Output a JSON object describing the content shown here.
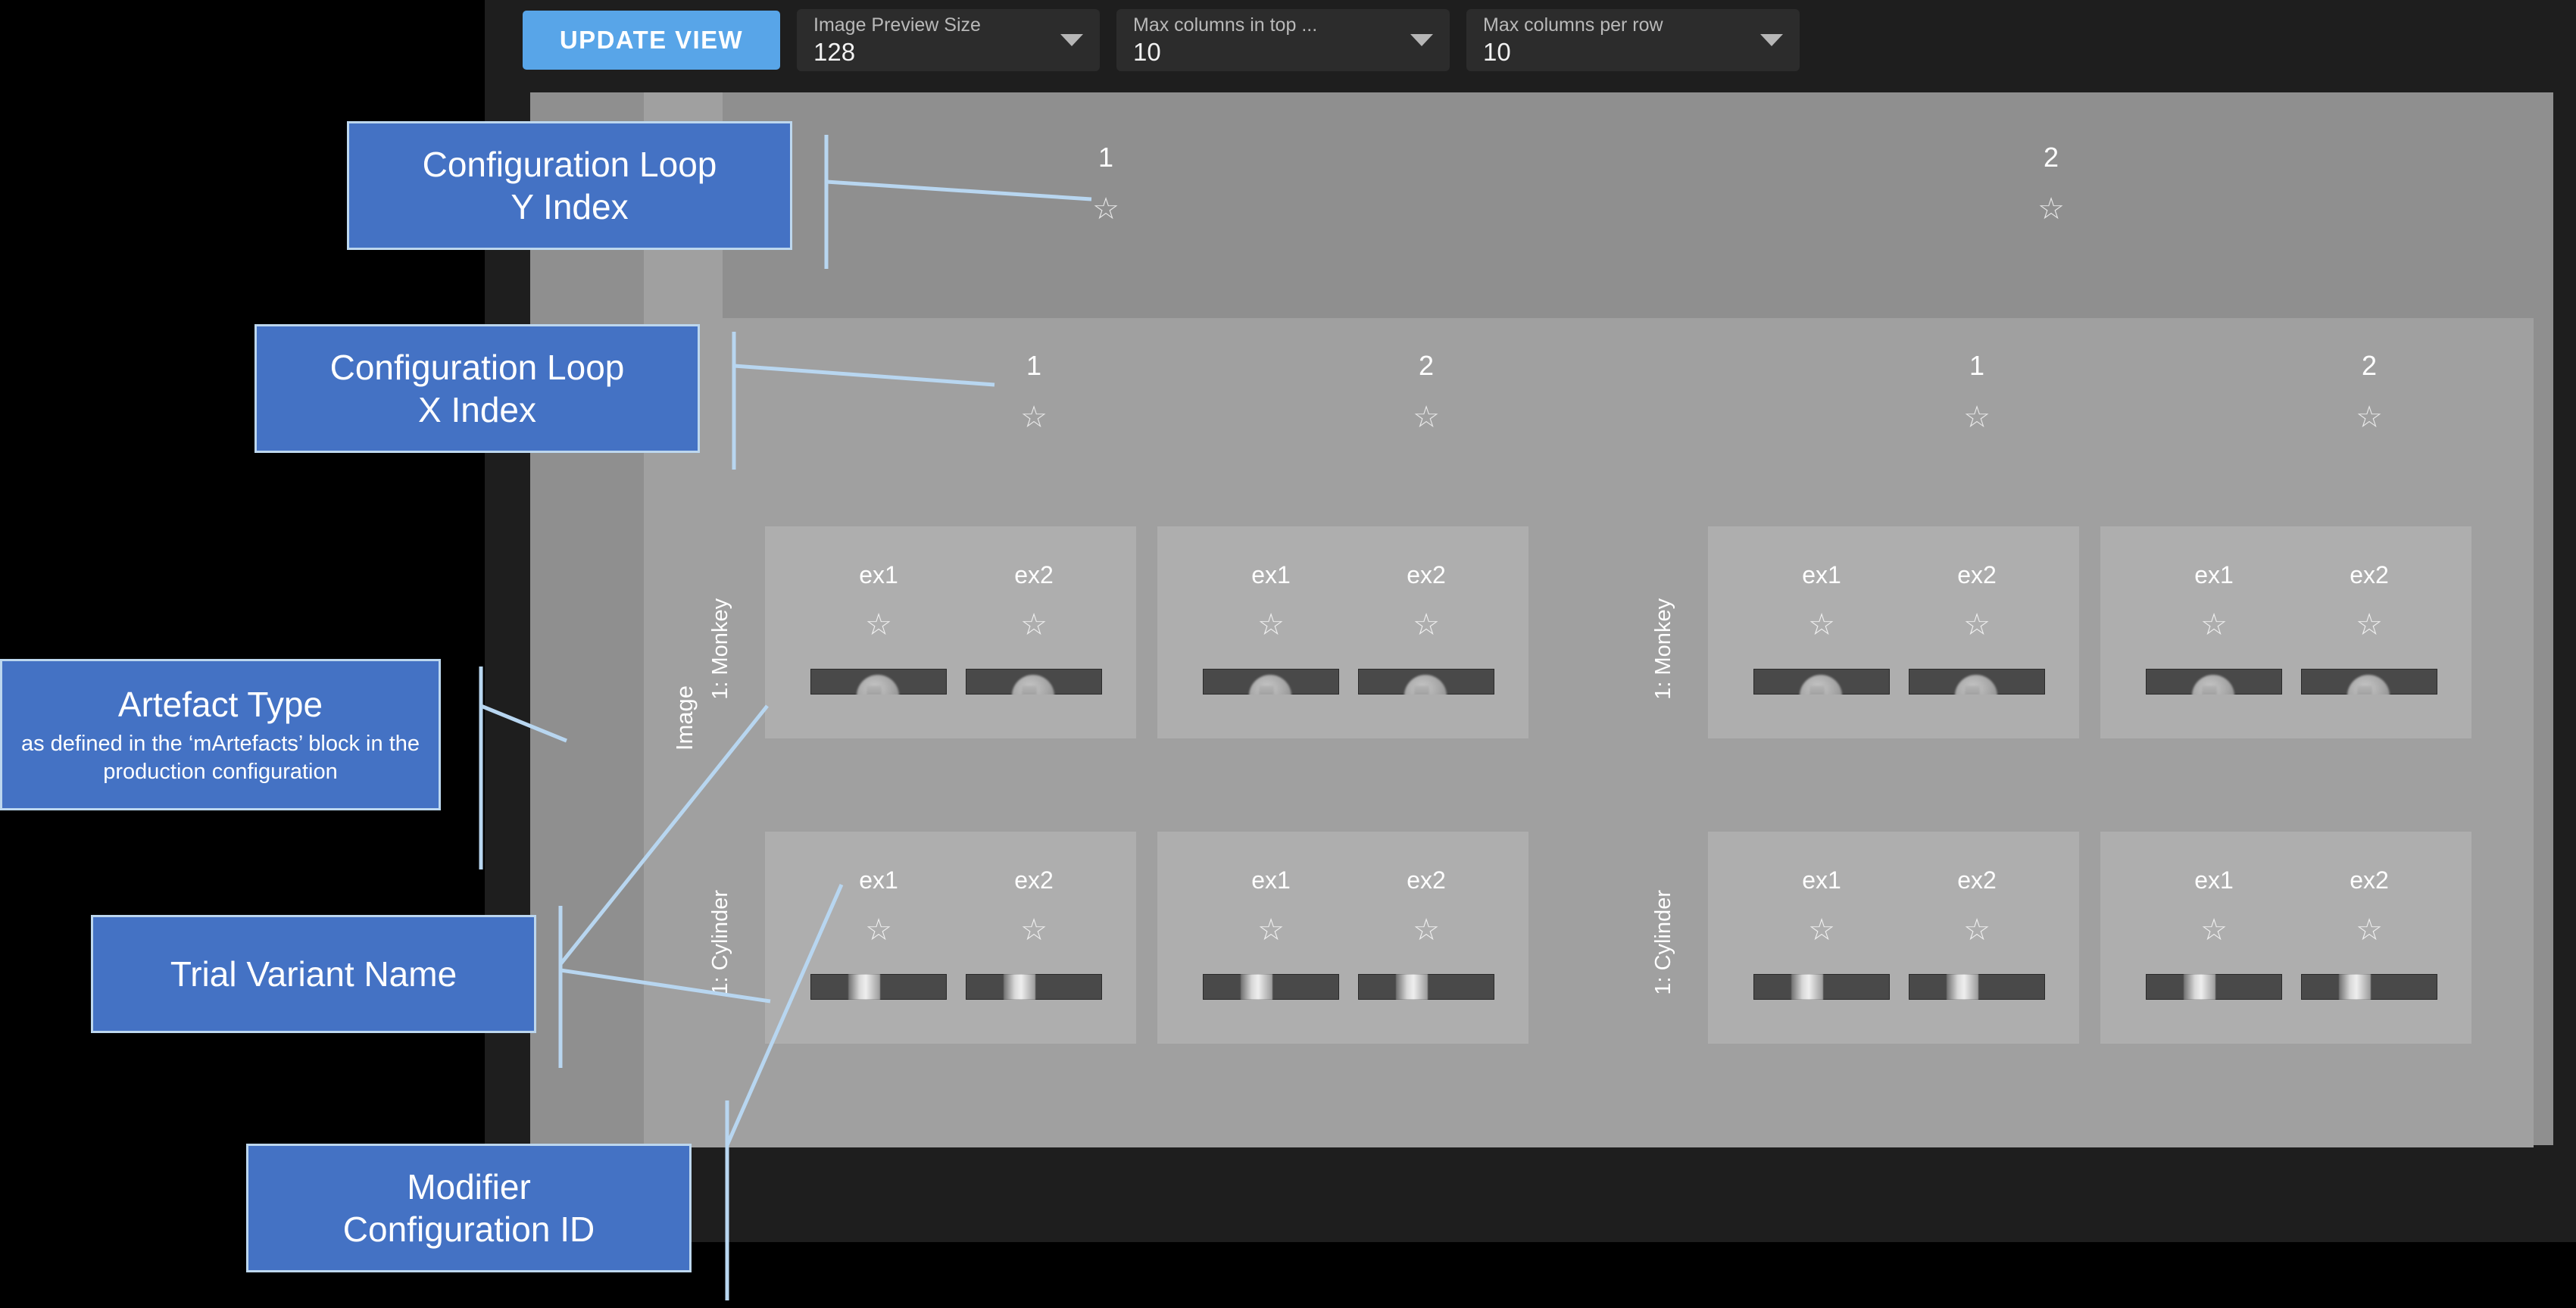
{
  "toolbar": {
    "update_button_label": "UPDATE VIEW",
    "controls": [
      {
        "label": "Image Preview Size",
        "value": "128",
        "arrow_icon": "chevron-down-icon"
      },
      {
        "label": "Max columns in top ...",
        "value": "10",
        "arrow_icon": "chevron-down-icon"
      },
      {
        "label": "Max columns per row",
        "value": "10",
        "arrow_icon": "chevron-down-icon"
      }
    ]
  },
  "colors": {
    "accent_blue": "#58a5e8",
    "callout_fill": "#4472c4",
    "callout_border": "#bdd7ee",
    "leader_line": "#b8d6f0",
    "panel_gray": "#8f8f8f",
    "group_gray": "#a0a0a0",
    "cell_gray": "#aeaeae",
    "toolbar_dark": "#2c2c2c",
    "chrome_dark": "#1e1e1e"
  },
  "annotations": [
    {
      "id": "y-index",
      "title": "Configuration Loop\nY Index",
      "line1": "Configuration Loop",
      "line2": "Y Index",
      "sub": ""
    },
    {
      "id": "x-index",
      "title": "Configuration Loop\nX Index",
      "line1": "Configuration Loop",
      "line2": "X Index",
      "sub": ""
    },
    {
      "id": "artefact-type",
      "line1": "Artefact Type",
      "line2": "",
      "sub": "as defined in the ‘mArtefacts’ block in the production configuration"
    },
    {
      "id": "trial-variant",
      "line1": "Trial Variant Name",
      "line2": "",
      "sub": ""
    },
    {
      "id": "modifier-id",
      "line1": "Modifier",
      "line2": "Configuration ID",
      "sub": ""
    }
  ],
  "viewer": {
    "artefact_column_label": "Image",
    "star_icon": "☆",
    "top_indices": [
      {
        "label": "1",
        "star": "☆"
      },
      {
        "label": "2",
        "star": "☆"
      }
    ],
    "groups": [
      {
        "y_index": "1",
        "x_indices": [
          {
            "label": "1",
            "star": "☆"
          },
          {
            "label": "2",
            "star": "☆"
          }
        ],
        "variants": [
          {
            "name": "1: Monkey",
            "cells": [
              {
                "artefacts": [
                  {
                    "name": "ex1",
                    "star": "☆",
                    "thumb": "monkey"
                  },
                  {
                    "name": "ex2",
                    "star": "☆",
                    "thumb": "monkey"
                  }
                ]
              },
              {
                "artefacts": [
                  {
                    "name": "ex1",
                    "star": "☆",
                    "thumb": "monkey"
                  },
                  {
                    "name": "ex2",
                    "star": "☆",
                    "thumb": "monkey"
                  }
                ]
              }
            ]
          },
          {
            "name": "1: Cylinder",
            "cells": [
              {
                "artefacts": [
                  {
                    "name": "ex1",
                    "star": "☆",
                    "thumb": "cylinder"
                  },
                  {
                    "name": "ex2",
                    "star": "☆",
                    "thumb": "cylinder"
                  }
                ]
              },
              {
                "artefacts": [
                  {
                    "name": "ex1",
                    "star": "☆",
                    "thumb": "cylinder"
                  },
                  {
                    "name": "ex2",
                    "star": "☆",
                    "thumb": "cylinder"
                  }
                ]
              }
            ]
          }
        ]
      },
      {
        "y_index": "2",
        "x_indices": [
          {
            "label": "1",
            "star": "☆"
          },
          {
            "label": "2",
            "star": "☆"
          }
        ],
        "variants": [
          {
            "name": "1: Monkey",
            "cells": [
              {
                "artefacts": [
                  {
                    "name": "ex1",
                    "star": "☆",
                    "thumb": "monkey"
                  },
                  {
                    "name": "ex2",
                    "star": "☆",
                    "thumb": "monkey"
                  }
                ]
              },
              {
                "artefacts": [
                  {
                    "name": "ex1",
                    "star": "☆",
                    "thumb": "monkey"
                  },
                  {
                    "name": "ex2",
                    "star": "☆",
                    "thumb": "monkey"
                  }
                ]
              }
            ]
          },
          {
            "name": "1: Cylinder",
            "cells": [
              {
                "artefacts": [
                  {
                    "name": "ex1",
                    "star": "☆",
                    "thumb": "cylinder"
                  },
                  {
                    "name": "ex2",
                    "star": "☆",
                    "thumb": "cylinder"
                  }
                ]
              },
              {
                "artefacts": [
                  {
                    "name": "ex1",
                    "star": "☆",
                    "thumb": "cylinder"
                  },
                  {
                    "name": "ex2",
                    "star": "☆",
                    "thumb": "cylinder"
                  }
                ]
              }
            ]
          }
        ]
      }
    ]
  }
}
